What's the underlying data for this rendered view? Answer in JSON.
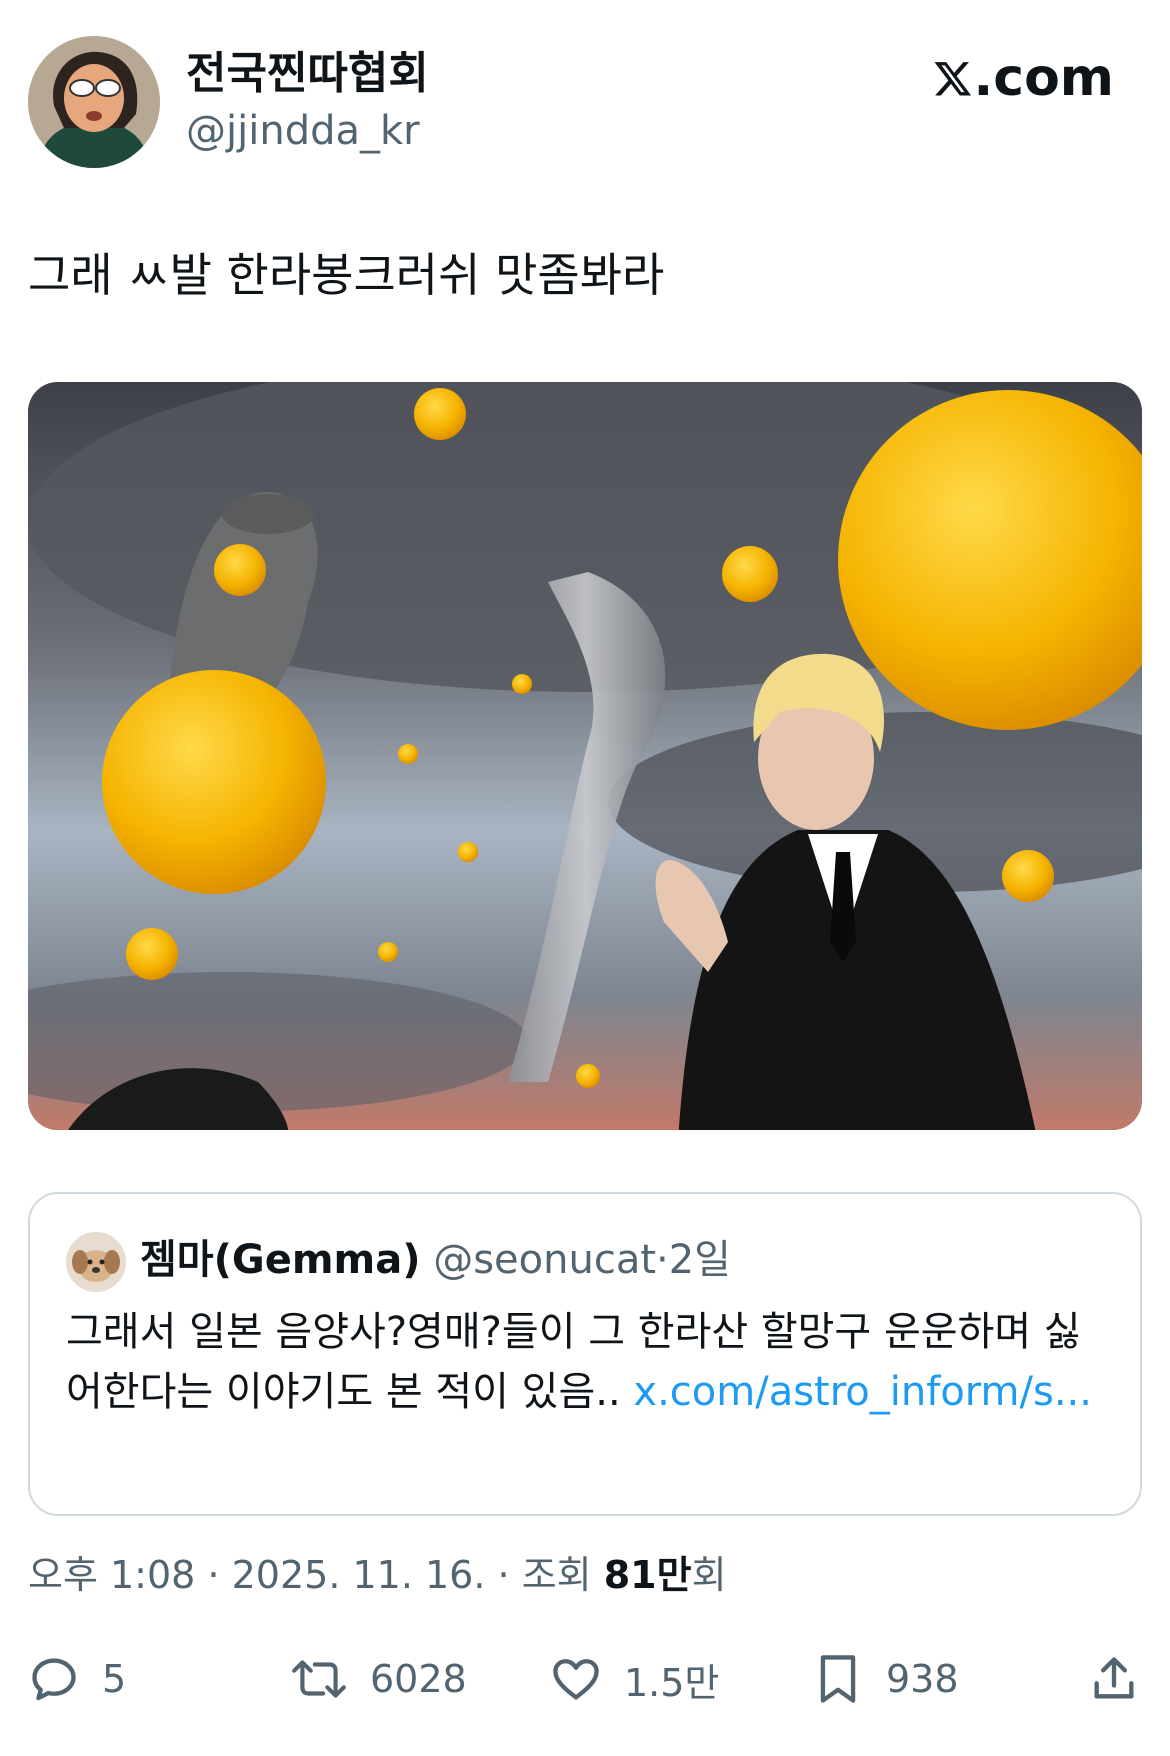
{
  "author": {
    "display_name": "전국찐따협회",
    "handle": "@jjindda_kr"
  },
  "brand_label": ".com",
  "brand_icon": "x-logo-icon",
  "tweet": {
    "text": "그래 ㅆ발 한라봉크러쉬 맛좀봐라"
  },
  "quoted_tweet": {
    "display_name": "젬마(Gemma)",
    "handle": "@seonucat",
    "separator": "·",
    "time": "2일",
    "text": "그래서 일본 음양사?영매?들이 그 한라산 할망구 운운하며 싫어한다는 이야기도 본 적이 있음.. ",
    "link_text": "x.com/​astro_inform/s..."
  },
  "meta": {
    "time": "오후 1:08",
    "separator": "·",
    "date": "2025. 11. 16.",
    "views_prefix": "조회",
    "views_count": "81만",
    "views_suffix": "회"
  },
  "actions": {
    "reply_count": "5",
    "retweet_count": "6028",
    "like_count": "1.5만",
    "bookmark_count": "938"
  },
  "colors": {
    "text": "#0f1419",
    "secondary": "#536471",
    "link": "#1d9bf0",
    "border": "#cfd9de"
  }
}
